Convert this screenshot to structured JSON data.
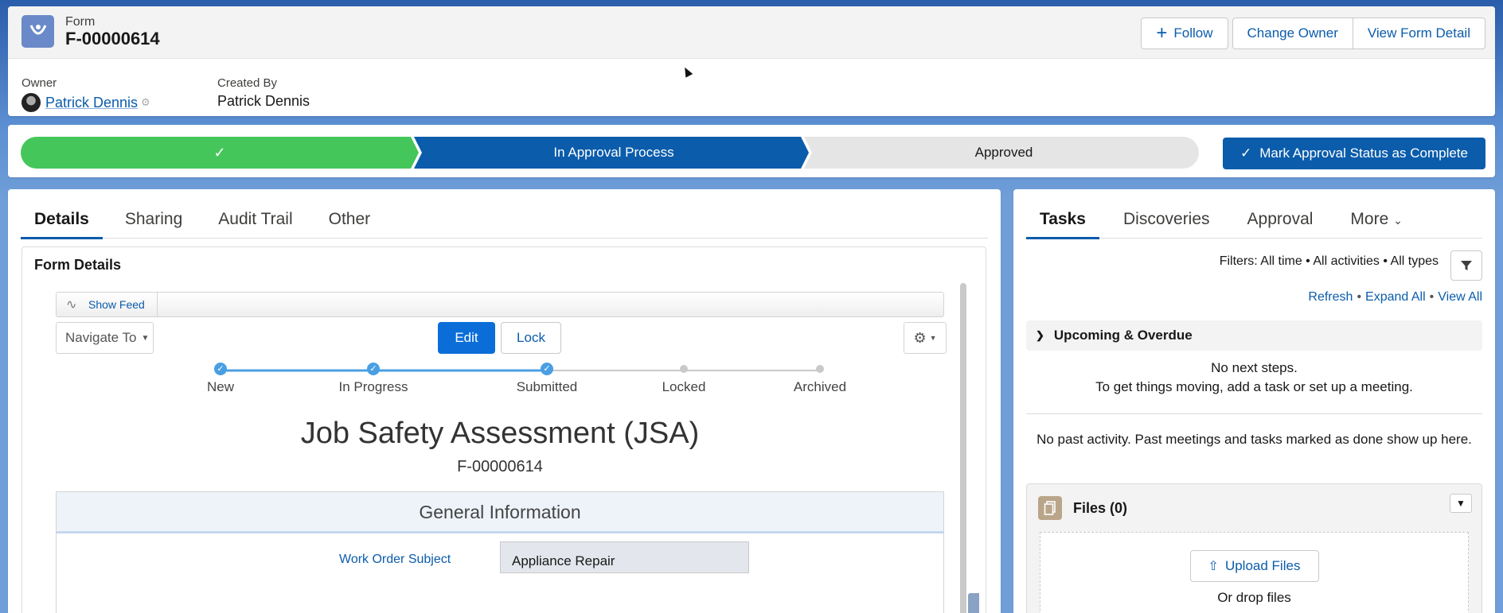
{
  "header": {
    "object_type": "Form",
    "record_title": "F-00000614",
    "actions": {
      "follow": "Follow",
      "change_owner": "Change Owner",
      "view_detail": "View Form Detail"
    },
    "owner_label": "Owner",
    "owner_name": "Patrick Dennis",
    "created_by_label": "Created By",
    "created_by_name": "Patrick Dennis"
  },
  "path": {
    "stages": [
      {
        "label": "",
        "state": "complete"
      },
      {
        "label": "In Approval Process",
        "state": "current"
      },
      {
        "label": "Approved",
        "state": "incomplete"
      }
    ],
    "complete_button": "Mark Approval Status as Complete",
    "colors": {
      "complete": "#45c65a",
      "current": "#0b5cab",
      "incomplete": "#e5e5e5"
    }
  },
  "main": {
    "tabs": [
      "Details",
      "Sharing",
      "Audit Trail",
      "Other"
    ],
    "section_title": "Form Details",
    "show_feed": "Show Feed",
    "navigate_to": "Navigate To",
    "edit": "Edit",
    "lock": "Lock",
    "progress": [
      {
        "label": "New",
        "done": true
      },
      {
        "label": "In Progress",
        "done": true
      },
      {
        "label": "Submitted",
        "done": true
      },
      {
        "label": "Locked",
        "done": false
      },
      {
        "label": "Archived",
        "done": false
      }
    ],
    "form_title": "Job Safety Assessment (JSA)",
    "form_number": "F-00000614",
    "general_info": "General Information",
    "work_order_label": "Work Order Subject",
    "work_order_value": "Appliance Repair"
  },
  "side": {
    "tabs": [
      "Tasks",
      "Discoveries",
      "Approval",
      "More"
    ],
    "filters": "Filters: All time • All activities • All types",
    "refresh": "Refresh",
    "expand_all": "Expand All",
    "view_all": "View All",
    "upcoming": "Upcoming & Overdue",
    "no_next": "No next steps.",
    "get_moving": "To get things moving, add a task or set up a meeting.",
    "no_past": "No past activity. Past meetings and tasks marked as done show up here.",
    "files_title": "Files (0)",
    "upload": "Upload Files",
    "or_drop": "Or drop files"
  }
}
